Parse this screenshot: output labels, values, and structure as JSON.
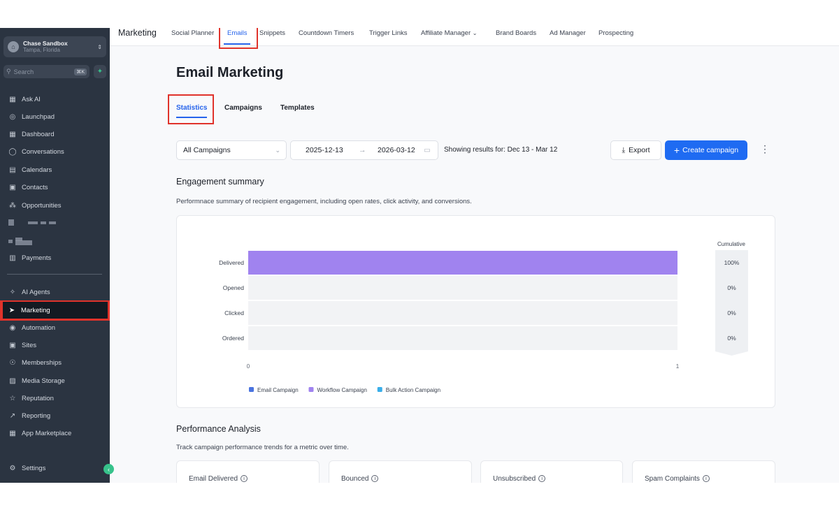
{
  "sidebar": {
    "account": {
      "name": "Chase Sandbox",
      "location": "Tampa, Florida"
    },
    "search": {
      "placeholder": "Search",
      "shortcut": "⌘K"
    },
    "items": [
      {
        "label": "Ask AI",
        "icon": "grid-icon"
      },
      {
        "label": "Launchpad",
        "icon": "rocket-icon"
      },
      {
        "label": "Dashboard",
        "icon": "dashboard-icon"
      },
      {
        "label": "Conversations",
        "icon": "chat-icon"
      },
      {
        "label": "Calendars",
        "icon": "calendar-icon"
      },
      {
        "label": "Contacts",
        "icon": "contacts-icon"
      },
      {
        "label": "Opportunities",
        "icon": "opportunities-icon"
      },
      {
        "label": "Payments",
        "icon": "payments-icon"
      },
      {
        "label": "AI Agents",
        "icon": "sparkle-icon"
      },
      {
        "label": "Marketing",
        "icon": "send-icon"
      },
      {
        "label": "Automation",
        "icon": "automation-icon"
      },
      {
        "label": "Sites",
        "icon": "sites-icon"
      },
      {
        "label": "Memberships",
        "icon": "membership-icon"
      },
      {
        "label": "Media Storage",
        "icon": "image-icon"
      },
      {
        "label": "Reputation",
        "icon": "star-icon"
      },
      {
        "label": "Reporting",
        "icon": "trend-icon"
      },
      {
        "label": "App Marketplace",
        "icon": "apps-icon"
      },
      {
        "label": "Settings",
        "icon": "gear-icon"
      }
    ]
  },
  "topbar": {
    "title": "Marketing",
    "tabs": [
      "Social Planner",
      "Emails",
      "Snippets",
      "Countdown Timers",
      "Trigger Links",
      "Affiliate Manager",
      "Brand Boards",
      "Ad Manager",
      "Prospecting"
    ]
  },
  "page": {
    "title": "Email Marketing",
    "subtabs": [
      "Statistics",
      "Campaigns",
      "Templates"
    ],
    "filter_select": "All Campaigns",
    "date_start": "2025-12-13",
    "date_end": "2026-03-12",
    "showing": "Showing results for: Dec 13 - Mar 12",
    "export_label": "Export",
    "create_label": "Create campaign"
  },
  "engagement": {
    "title": "Engagement summary",
    "description": "Performnace summary of recipient engagement, including open rates, click activity, and conversions."
  },
  "performance": {
    "title": "Performance Analysis",
    "description": "Track campaign performance trends for a metric over time.",
    "metrics": [
      "Email Delivered",
      "Bounced",
      "Unsubscribed",
      "Spam Complaints"
    ]
  },
  "chart_data": {
    "type": "bar",
    "orientation": "horizontal",
    "categories": [
      "Delivered",
      "Opened",
      "Clicked",
      "Ordered"
    ],
    "values": [
      1,
      0,
      0,
      0
    ],
    "xlim": [
      0,
      1
    ],
    "x_ticks": [
      "0",
      "1"
    ],
    "cumulative_title": "Cumulative",
    "cumulative": [
      "100%",
      "0%",
      "0%",
      "0%"
    ],
    "legend": [
      {
        "name": "Email Campaign",
        "color": "#4a74e0"
      },
      {
        "name": "Workflow Campaign",
        "color": "#a083ef"
      },
      {
        "name": "Bulk Action Campaign",
        "color": "#3aaee9"
      }
    ],
    "bar_color": "#a083ef",
    "track_color": "#f2f3f5"
  }
}
